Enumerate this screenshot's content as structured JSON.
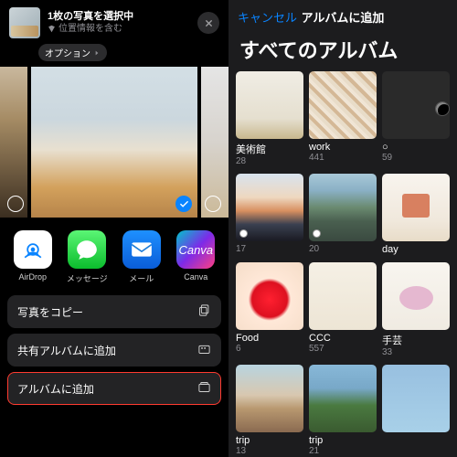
{
  "left": {
    "header": {
      "title": "1枚の写真を選択中",
      "subtitle": "位置情報を含む",
      "options_btn": "オプション"
    },
    "apps": [
      {
        "label": "AirDrop",
        "icon": "airdrop"
      },
      {
        "label": "メッセージ",
        "icon": "msg"
      },
      {
        "label": "メール",
        "icon": "mail"
      },
      {
        "label": "Canva",
        "icon": "canva",
        "glyph": "Canva"
      }
    ],
    "actions": [
      {
        "label": "写真をコピー",
        "icon": "copy",
        "highlight": false
      },
      {
        "label": "共有アルバムに追加",
        "icon": "shared-album",
        "highlight": false
      },
      {
        "label": "アルバムに追加",
        "icon": "album",
        "highlight": true
      }
    ]
  },
  "right": {
    "cancel": "キャンセル",
    "title_small": "アルバムに追加",
    "title_big": "すべてのアルバム",
    "albums": [
      {
        "name": "美術館",
        "count": "28",
        "thumb": "th-museum"
      },
      {
        "name": "work",
        "count": "441",
        "thumb": "th-work"
      },
      {
        "name": "○",
        "count": "59",
        "thumb": "th-circle"
      },
      {
        "name": "",
        "count": "17",
        "thumb": "th-sunset",
        "dot": true
      },
      {
        "name": "",
        "count": "20",
        "thumb": "th-cafe",
        "dot": true
      },
      {
        "name": "day",
        "count": "",
        "thumb": "th-day"
      },
      {
        "name": "Food",
        "count": "6",
        "thumb": "th-food"
      },
      {
        "name": "CCC",
        "count": "557",
        "thumb": "th-ccc"
      },
      {
        "name": "手芸",
        "count": "33",
        "thumb": "th-craft"
      },
      {
        "name": "trip",
        "count": "13",
        "thumb": "th-trip1"
      },
      {
        "name": "trip",
        "count": "21",
        "thumb": "th-trip2"
      },
      {
        "name": "",
        "count": "",
        "thumb": "th-blank"
      }
    ]
  }
}
